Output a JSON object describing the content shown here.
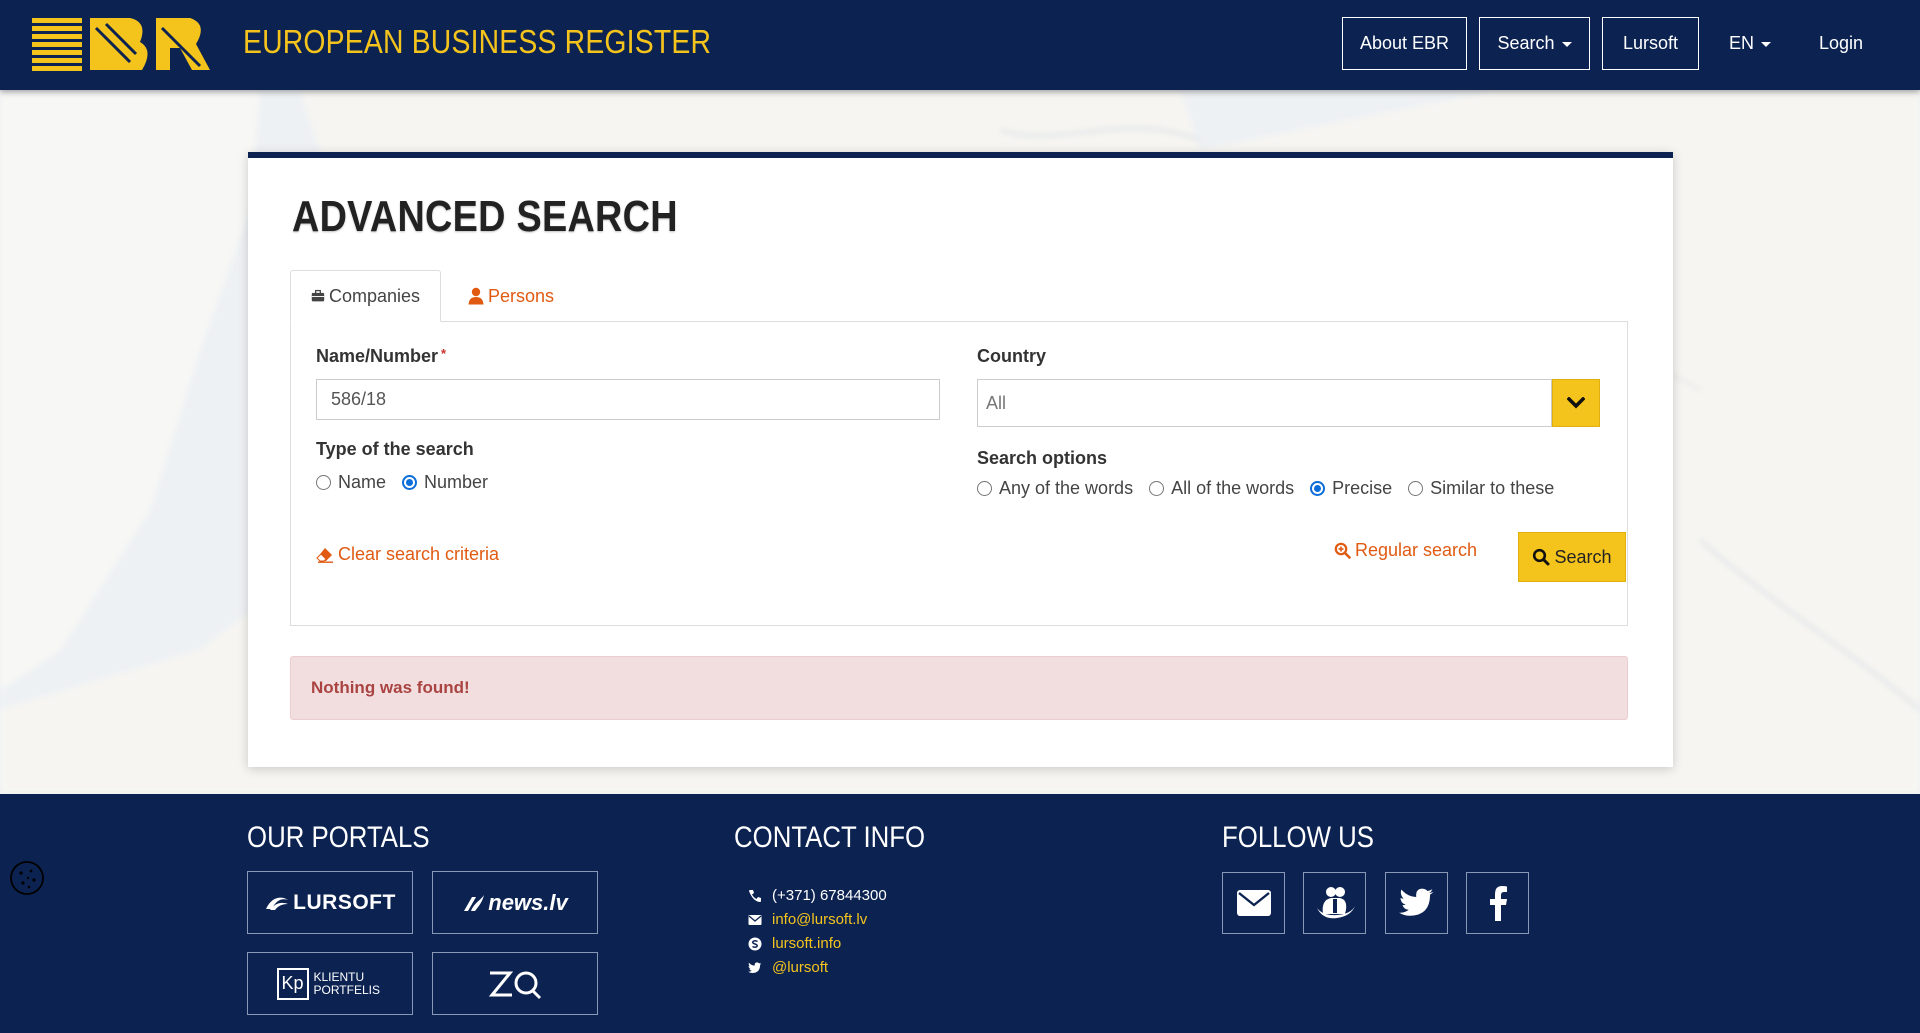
{
  "header": {
    "brand_title": "EUROPEAN BUSINESS REGISTER",
    "nav": {
      "about": "About EBR",
      "search": "Search",
      "lursoft": "Lursoft",
      "language": "EN",
      "login": "Login"
    }
  },
  "main": {
    "title": "ADVANCED SEARCH",
    "tabs": [
      {
        "label": "Companies",
        "active": true
      },
      {
        "label": "Persons",
        "active": false
      }
    ],
    "form": {
      "name_label": "Name/Number",
      "required_mark": "*",
      "name_value": "586/18",
      "type_label": "Type of the search",
      "type_options": [
        {
          "label": "Name",
          "checked": false
        },
        {
          "label": "Number",
          "checked": true
        }
      ],
      "country_label": "Country",
      "country_value": "All",
      "options_label": "Search options",
      "search_options": [
        {
          "label": "Any of the words",
          "checked": false
        },
        {
          "label": "All of the words",
          "checked": false
        },
        {
          "label": "Precise",
          "checked": true
        },
        {
          "label": "Similar to these",
          "checked": false
        }
      ],
      "clear_label": "Clear search criteria",
      "regular_search_label": "Regular search",
      "search_button_label": "Search"
    },
    "alert": "Nothing was found!"
  },
  "footer": {
    "portals_title": "OUR PORTALS",
    "contact_title": "CONTACT INFO",
    "follow_title": "FOLLOW US",
    "portals": [
      {
        "name": "LURSOFT",
        "icon": "lursoft-logo"
      },
      {
        "name": "news.lv",
        "icon": "newslv-logo"
      },
      {
        "name": "KLIENTU PORTFELIS",
        "badge": "Kp",
        "icon": "klientu-portfelis-logo"
      },
      {
        "name": "ZQ",
        "icon": "zq-logo"
      }
    ],
    "contacts": {
      "phone": "(+371) 67844300",
      "email": "info@lursoft.lv",
      "skype": "lursoft.info",
      "twitter": "@lursoft"
    },
    "social": [
      "mail-icon",
      "draugiem-icon",
      "twitter-icon",
      "facebook-icon"
    ]
  },
  "colors": {
    "navy": "#0c2352",
    "brand_yellow": "#f5c41c",
    "link_orange": "#e05a12",
    "alert_bg": "#f2dede",
    "alert_text": "#a94442",
    "radio_blue": "#0b6dd9"
  }
}
